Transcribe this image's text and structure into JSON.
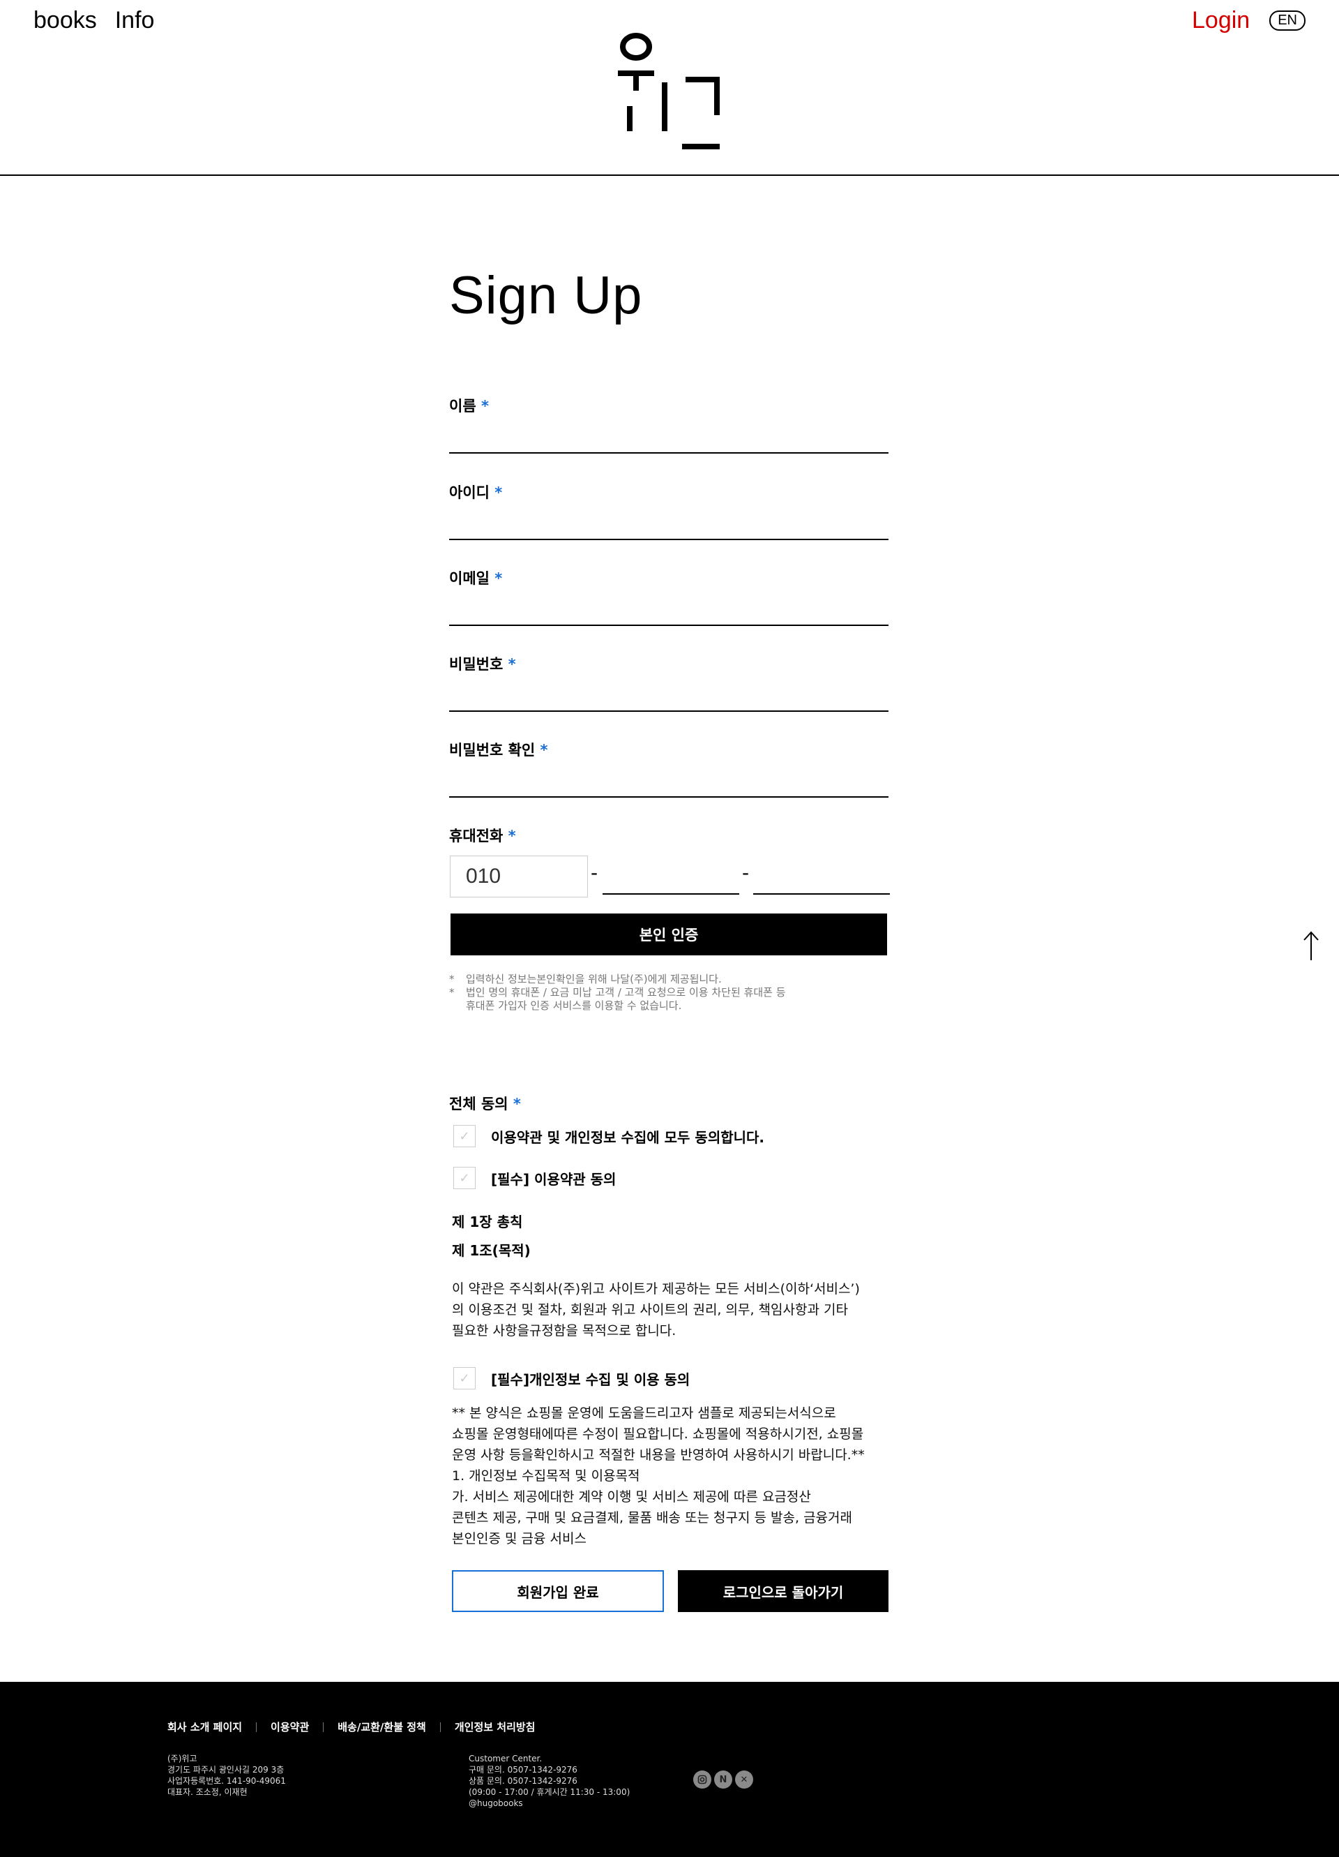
{
  "header": {
    "nav": [
      "books",
      "Info"
    ],
    "login": "Login",
    "lang": "EN",
    "logo_text": "위고"
  },
  "page_title": "Sign Up",
  "required_mark": "*",
  "fields": {
    "name": "이름",
    "id": "아이디",
    "email": "이메일",
    "password": "비밀번호",
    "password_confirm": "비밀번호 확인",
    "phone": "휴대전화"
  },
  "phone": {
    "prefix": "010",
    "dash": "-"
  },
  "verify_button": "본인 인증",
  "notes": [
    "입력하신 정보는본인확인을 위해 나달(주)에게 제공됩니다.",
    "법인 명의 휴대폰 / 요금 미납 고객 / 고객 요청으로 이용 차단된 휴대폰 등",
    "휴대폰 가입자 인증 서비스를 이용할 수 없습니다."
  ],
  "agreement": {
    "title": "전체 동의",
    "all": "이용약관 및 개인정보 수집에 모두 동의합니다.",
    "terms": "[필수] 이용약관 동의",
    "chapter": "제 1장 총칙",
    "article": "제 1조(목적)",
    "terms_body": [
      "이 약관은 주식회사(주)위고 사이트가 제공하는 모든 서비스(이하‘서비스’)",
      "의 이용조건 및 절차, 회원과 위고 사이트의 권리, 의무, 책임사항과 기타",
      "필요한 사항을규정함을 목적으로 합니다."
    ],
    "privacy": "[필수]개인정보 수집 및 이용 동의",
    "privacy_body": [
      "** 본 양식은 쇼핑몰 운영에 도움을드리고자 샘플로 제공되는서식으로",
      "쇼핑몰 운영형태에따른 수정이 필요합니다. 쇼핑몰에 적용하시기전, 쇼핑몰",
      "운영 사항 등을확인하시고 적절한 내용을 반영하여 사용하시기 바랍니다.**",
      "1.    개인정보 수집목적 및 이용목적",
      "가.    서비스 제공에대한 계약 이행 및 서비스 제공에 따른 요금정산",
      "콘텐츠 제공, 구매 및 요금결제, 물품 배송 또는 청구지 등 발송, 금융거래",
      "본인인증 및 금융 서비스"
    ]
  },
  "buttons": {
    "complete": "회원가입 완료",
    "back": "로그인으로 돌아가기"
  },
  "footer": {
    "links": [
      "회사 소개 페이지",
      "이용약관",
      "배송/교환/환불 정책",
      "개인정보 처리방침"
    ],
    "company": [
      "(주)위고",
      "경기도 파주시 광인사길 209 3층",
      "사업자등록번호. 141-90-49061",
      "대표자. 조소정, 이재현"
    ],
    "cs": [
      "Customer Center.",
      "구매 문의. 0507-1342-9276",
      "상품 문의. 0507-1342-9276",
      "(09:00 - 17:00 / 휴게시간 11:30 - 13:00)",
      "@hugobooks"
    ],
    "social": [
      "instagram-icon",
      "naver-icon",
      "x-icon"
    ]
  }
}
